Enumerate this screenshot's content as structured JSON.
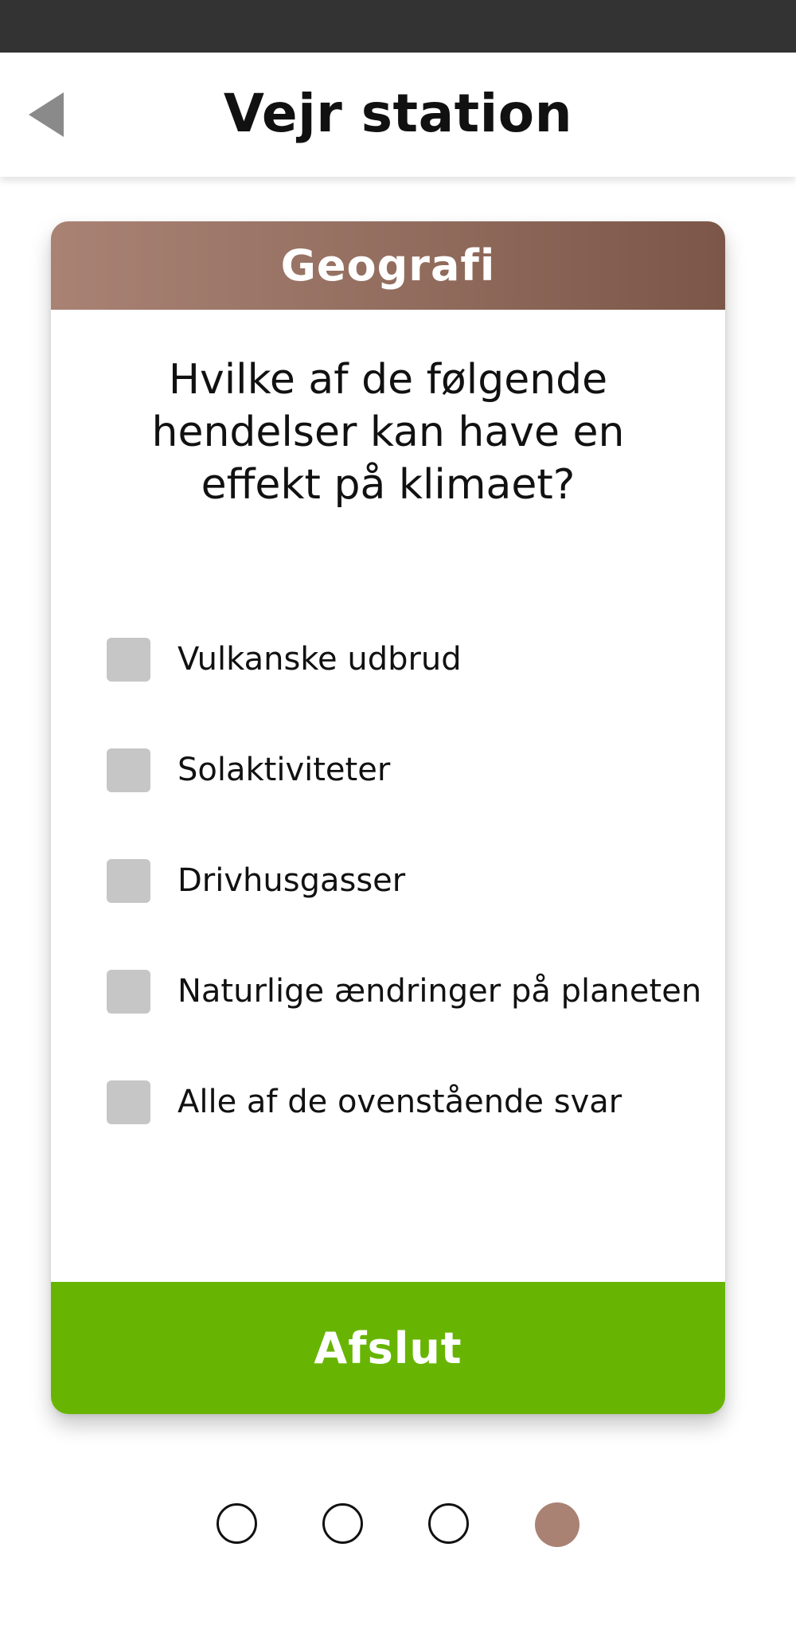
{
  "header": {
    "title": "Vejr station",
    "back_icon": "back-arrow-icon"
  },
  "card": {
    "subject": "Geografi",
    "question": "Hvilke af de følgende hendelser kan have en effekt på klimaet?",
    "options": [
      {
        "label": "Vulkanske udbrud",
        "checked": false
      },
      {
        "label": "Solaktiviteter",
        "checked": false
      },
      {
        "label": "Drivhusgasser",
        "checked": false
      },
      {
        "label": "Naturlige ændringer på planeten",
        "checked": false
      },
      {
        "label": "Alle af de ovenstående svar",
        "checked": false
      }
    ],
    "finish_label": "Afslut"
  },
  "pager": {
    "total": 4,
    "current": 4
  },
  "colors": {
    "status_bar": "#333333",
    "header_gradient_start": "#a98274",
    "header_gradient_end": "#7c5648",
    "finish_button": "#67b502",
    "checkbox": "#c6c6c6",
    "active_dot": "#a98274"
  }
}
